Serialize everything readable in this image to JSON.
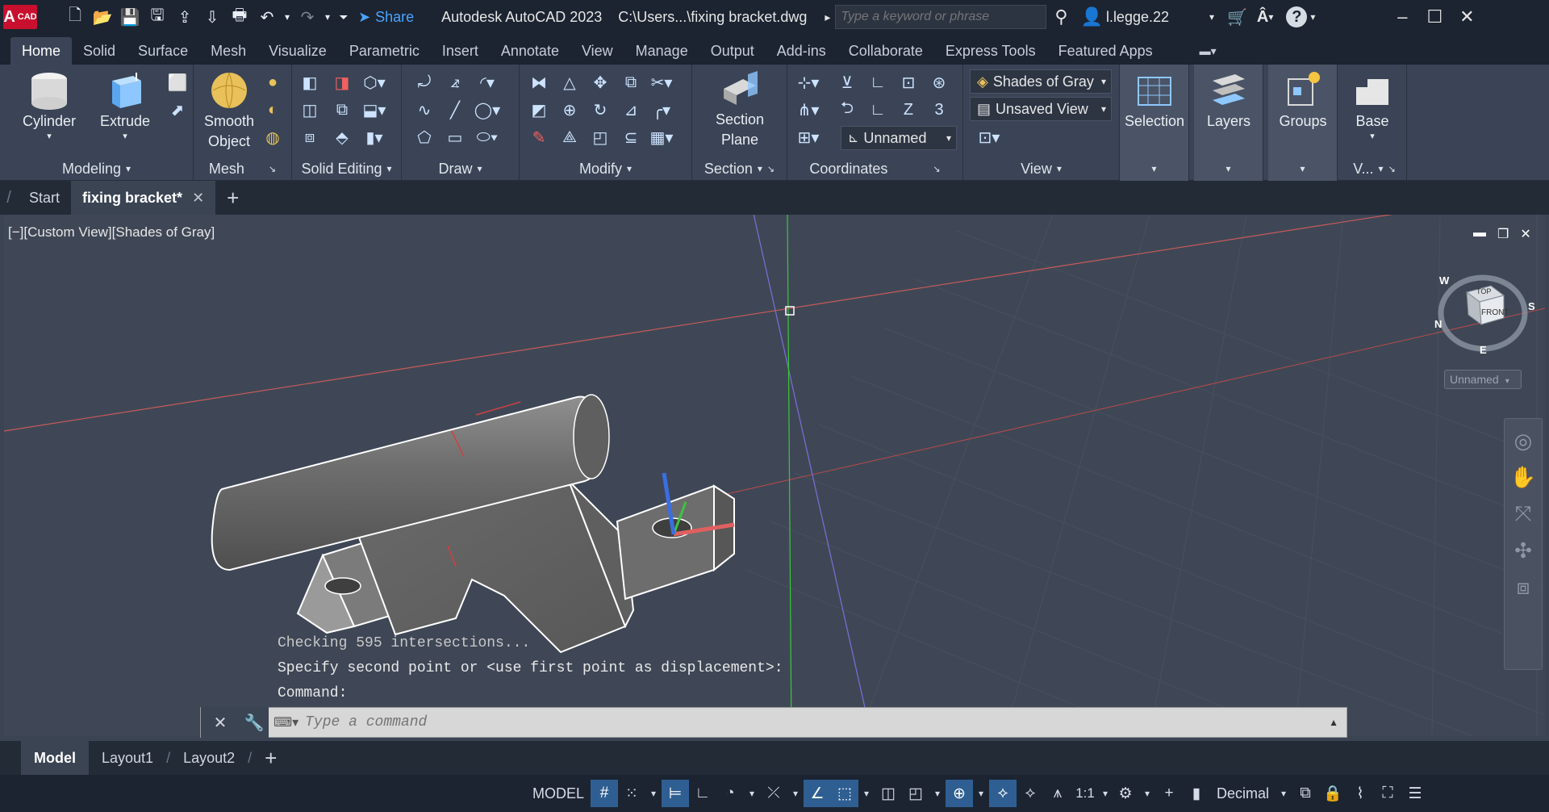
{
  "app": {
    "title": "Autodesk AutoCAD 2023",
    "file_path": "C:\\Users...\\fixing bracket.dwg",
    "logo_badge": "CAD",
    "logo_letter": "A"
  },
  "titlebar": {
    "share": "Share",
    "search_placeholder": "Type a keyword or phrase",
    "user": "l.legge.22"
  },
  "ribbon_tabs": [
    "Home",
    "Solid",
    "Surface",
    "Mesh",
    "Visualize",
    "Parametric",
    "Insert",
    "Annotate",
    "View",
    "Manage",
    "Output",
    "Add-ins",
    "Collaborate",
    "Express Tools",
    "Featured Apps"
  ],
  "ribbon": {
    "modeling": {
      "label": "Modeling",
      "cylinder": "Cylinder",
      "extrude": "Extrude"
    },
    "mesh": {
      "label": "Mesh",
      "smooth_object": "Smooth Object"
    },
    "solid_editing": {
      "label": "Solid Editing"
    },
    "draw": {
      "label": "Draw"
    },
    "modify": {
      "label": "Modify"
    },
    "section": {
      "label": "Section",
      "section_plane": "Section Plane"
    },
    "coordinates": {
      "label": "Coordinates",
      "ucs_name": "Unnamed"
    },
    "view": {
      "label": "View",
      "visual_style": "Shades of Gray",
      "named_view": "Unsaved View"
    },
    "selection": {
      "label": "Selection"
    },
    "layers": {
      "label": "Layers"
    },
    "groups": {
      "label": "Groups"
    },
    "base": {
      "label": "Base",
      "panel": "V..."
    }
  },
  "file_tabs": [
    "Start",
    "fixing bracket*"
  ],
  "viewport": {
    "label": "[−][Custom View][Shades of Gray]",
    "viewcube_top": "TOP",
    "viewcube_front": "FRONT",
    "compass": [
      "W",
      "S",
      "N",
      "E"
    ],
    "ucs_menu": "Unnamed"
  },
  "command": {
    "history": [
      "Checking 595 intersections...",
      "Specify second point or <use first point as displacement>:",
      "Command:"
    ],
    "placeholder": "Type a command"
  },
  "layout_tabs": [
    "Model",
    "Layout1",
    "Layout2"
  ],
  "statusbar": {
    "model": "MODEL",
    "scale": "1:1",
    "units": "Decimal"
  },
  "colors": {
    "title_bg": "#1c2431",
    "ribbon_bg": "#3a4456",
    "viewport_bg": "#3f4756",
    "accent": "#2f5f92"
  }
}
